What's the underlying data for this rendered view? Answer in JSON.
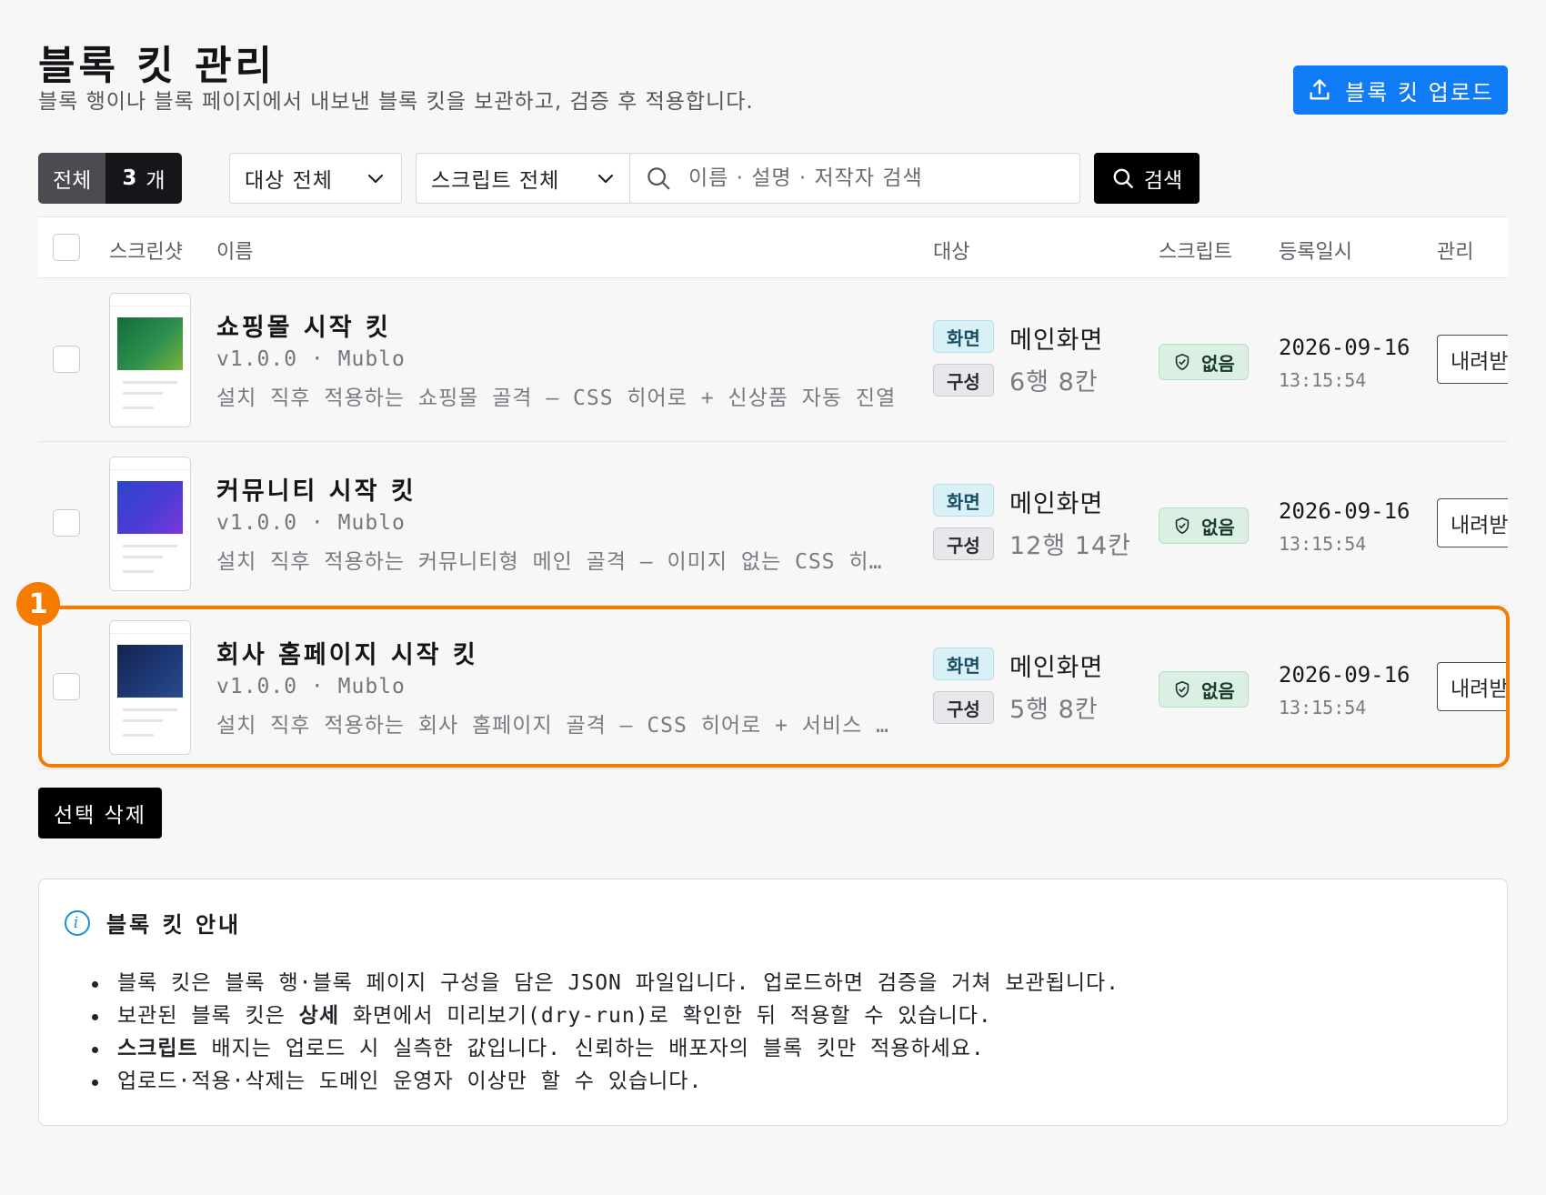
{
  "header": {
    "title": "블록 킷 관리",
    "subtitle": "블록 행이나 블록 페이지에서 내보낸 블록 킷을 보관하고, 검증 후 적용합니다.",
    "upload_label": "블록 킷 업로드"
  },
  "toolbar": {
    "count_label": "전체",
    "count_value": "3",
    "count_unit": "개",
    "target_select": "대상 전체",
    "script_select": "스크립트 전체",
    "search_placeholder": "이름 · 설명 · 저작자 검색",
    "search_label": "검색"
  },
  "table": {
    "columns": {
      "screenshot": "스크린샷",
      "name": "이름",
      "target": "대상",
      "script": "스크립트",
      "registered": "등록일시",
      "manage": "관리"
    },
    "rows": [
      {
        "name": "쇼핑몰 시작 킷",
        "meta": "v1.0.0 · Mublo",
        "desc": "설치 직후 적용하는 쇼핑몰 골격 — CSS 히어로 + 신상품 자동 진열",
        "target_badge": "화면",
        "target_value": "메인화면",
        "comp_badge": "구성",
        "comp_value": "6행 8칸",
        "script": "없음",
        "date": "2026-09-16",
        "time": "13:15:54",
        "action": "내려받기",
        "thumb_color": "#1f7a4a"
      },
      {
        "name": "커뮤니티 시작 킷",
        "meta": "v1.0.0 · Mublo",
        "desc": "설치 직후 적용하는 커뮤니티형 메인 골격 — 이미지 없는 CSS 히어로",
        "target_badge": "화면",
        "target_value": "메인화면",
        "comp_badge": "구성",
        "comp_value": "12행 14칸",
        "script": "없음",
        "date": "2026-09-16",
        "time": "13:15:54",
        "action": "내려받기",
        "thumb_color": "#3b3fd1"
      },
      {
        "name": "회사 홈페이지 시작 킷",
        "meta": "v1.0.0 · Mublo",
        "desc": "설치 직후 적용하는 회사 홈페이지 골격 — CSS 히어로 + 서비스 소개",
        "target_badge": "화면",
        "target_value": "메인화면",
        "comp_badge": "구성",
        "comp_value": "5행 8칸",
        "script": "없음",
        "date": "2026-09-16",
        "time": "13:15:54",
        "action": "내려받기",
        "thumb_color": "#1c3266"
      }
    ]
  },
  "highlight_marker": "1",
  "delete_label": "선택 삭제",
  "info": {
    "title": "블록 킷 안내",
    "items": [
      {
        "pre": "블록 킷은 블록 행·블록 페이지 구성을 담은 JSON 파일입니다. 업로드하면 검증을 거쳐 보관됩니다.",
        "bold": "",
        "post": ""
      },
      {
        "pre": "보관된 블록 킷은 ",
        "bold": "상세",
        "post": " 화면에서 미리보기(dry-run)로 확인한 뒤 적용할 수 있습니다."
      },
      {
        "pre": "",
        "bold": "스크립트",
        "post": " 배지는 업로드 시 실측한 값입니다. 신뢰하는 배포자의 블록 킷만 적용하세요."
      },
      {
        "pre": "업로드·적용·삭제는 도메인 운영자 이상만 할 수 있습니다.",
        "bold": "",
        "post": ""
      }
    ]
  },
  "colors": {
    "primary": "#0f7bf5",
    "highlight": "#f57c00",
    "screen_badge": "#d8f0f6",
    "script_badge": "#dcefe3"
  },
  "icons": [
    "upload-icon",
    "chevron-down-icon",
    "search-icon",
    "shield-check-icon",
    "info-icon"
  ]
}
